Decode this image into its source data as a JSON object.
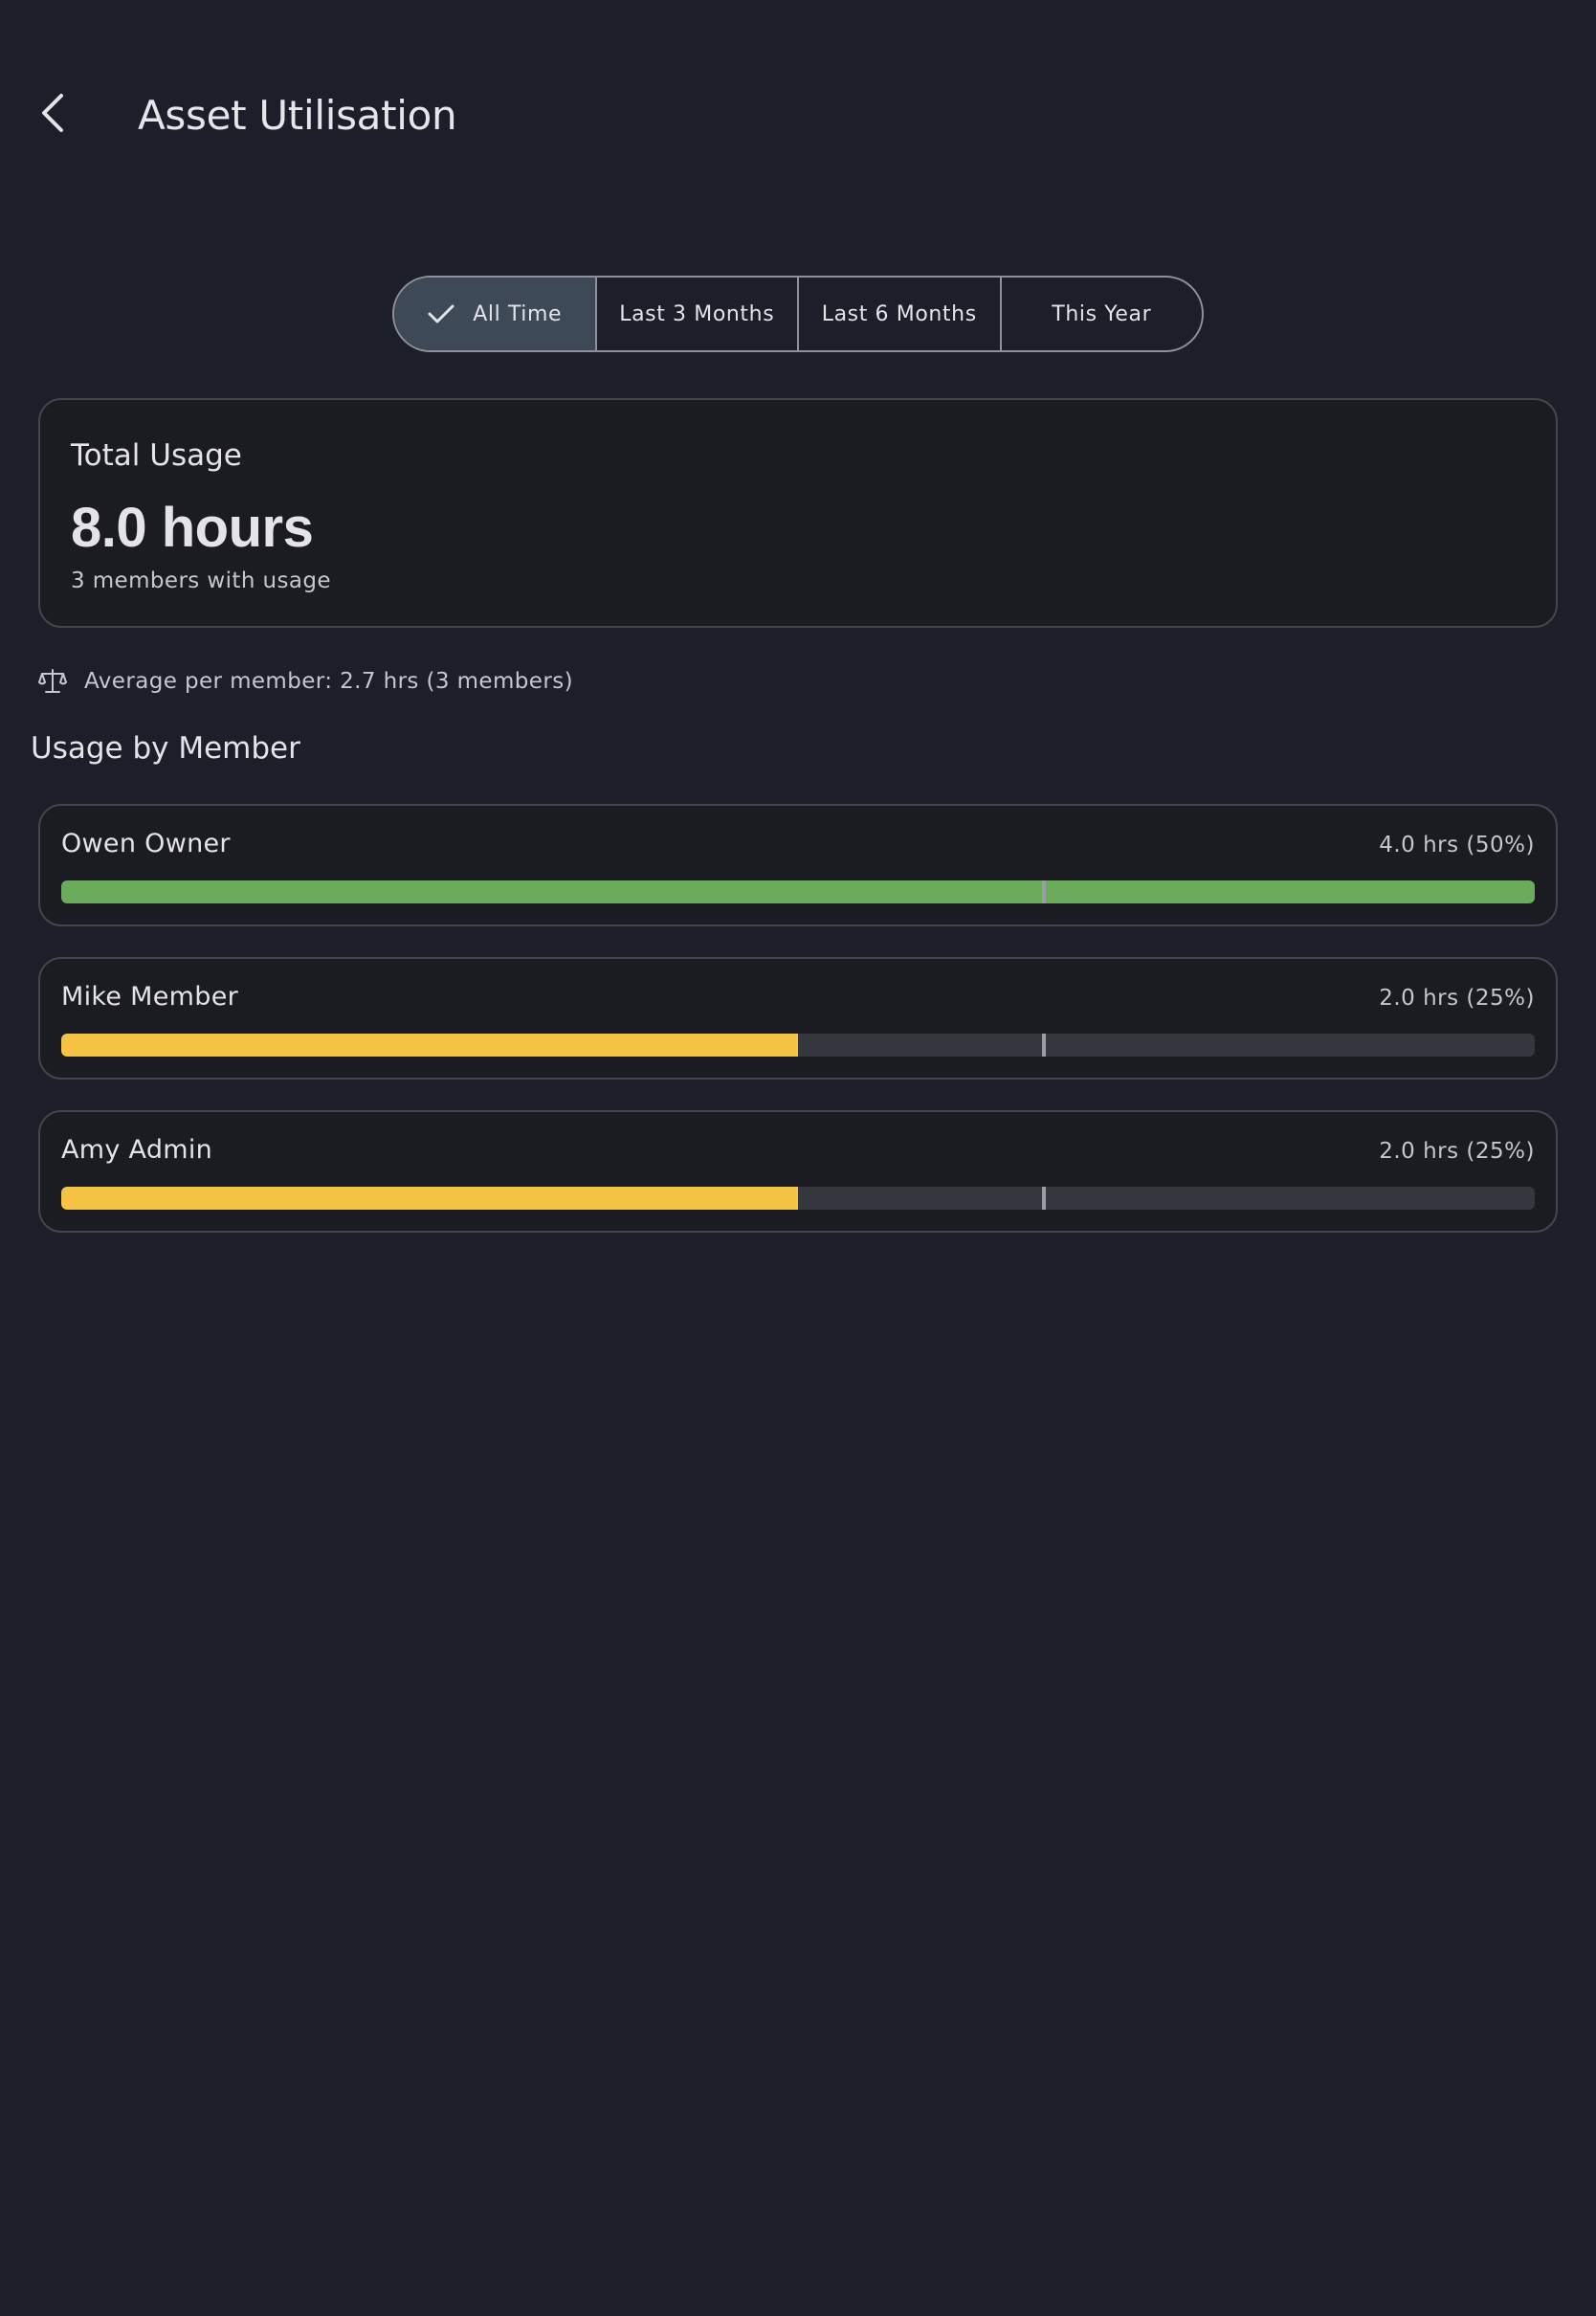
{
  "header": {
    "title": "Asset Utilisation",
    "back_icon": "chevron-left-icon"
  },
  "filters": {
    "options": [
      {
        "label": "All Time",
        "selected": true
      },
      {
        "label": "Last 3 Months",
        "selected": false
      },
      {
        "label": "Last 6 Months",
        "selected": false
      },
      {
        "label": "This Year",
        "selected": false
      }
    ],
    "check_icon": "check-icon"
  },
  "summary": {
    "label": "Total Usage",
    "value": "8.0 hours",
    "sub": "3 members with usage"
  },
  "average": {
    "icon": "scale-icon",
    "text": "Average per member: 2.7 hrs (3 members)",
    "fraction_of_max": 0.667
  },
  "section_title": "Usage by Member",
  "members": [
    {
      "name": "Owen Owner",
      "hours": "4.0 hrs (50%)",
      "fraction_of_max": 1.0,
      "color": "#6aac5b"
    },
    {
      "name": "Mike Member",
      "hours": "2.0 hrs (25%)",
      "fraction_of_max": 0.5,
      "color": "#f5c445"
    },
    {
      "name": "Amy Admin",
      "hours": "2.0 hrs (25%)",
      "fraction_of_max": 0.5,
      "color": "#f5c445"
    }
  ],
  "colors": {
    "background": "#1c1f29",
    "card": "#1a1c22",
    "selected_segment": "#3d4957",
    "track": "#35373e"
  }
}
